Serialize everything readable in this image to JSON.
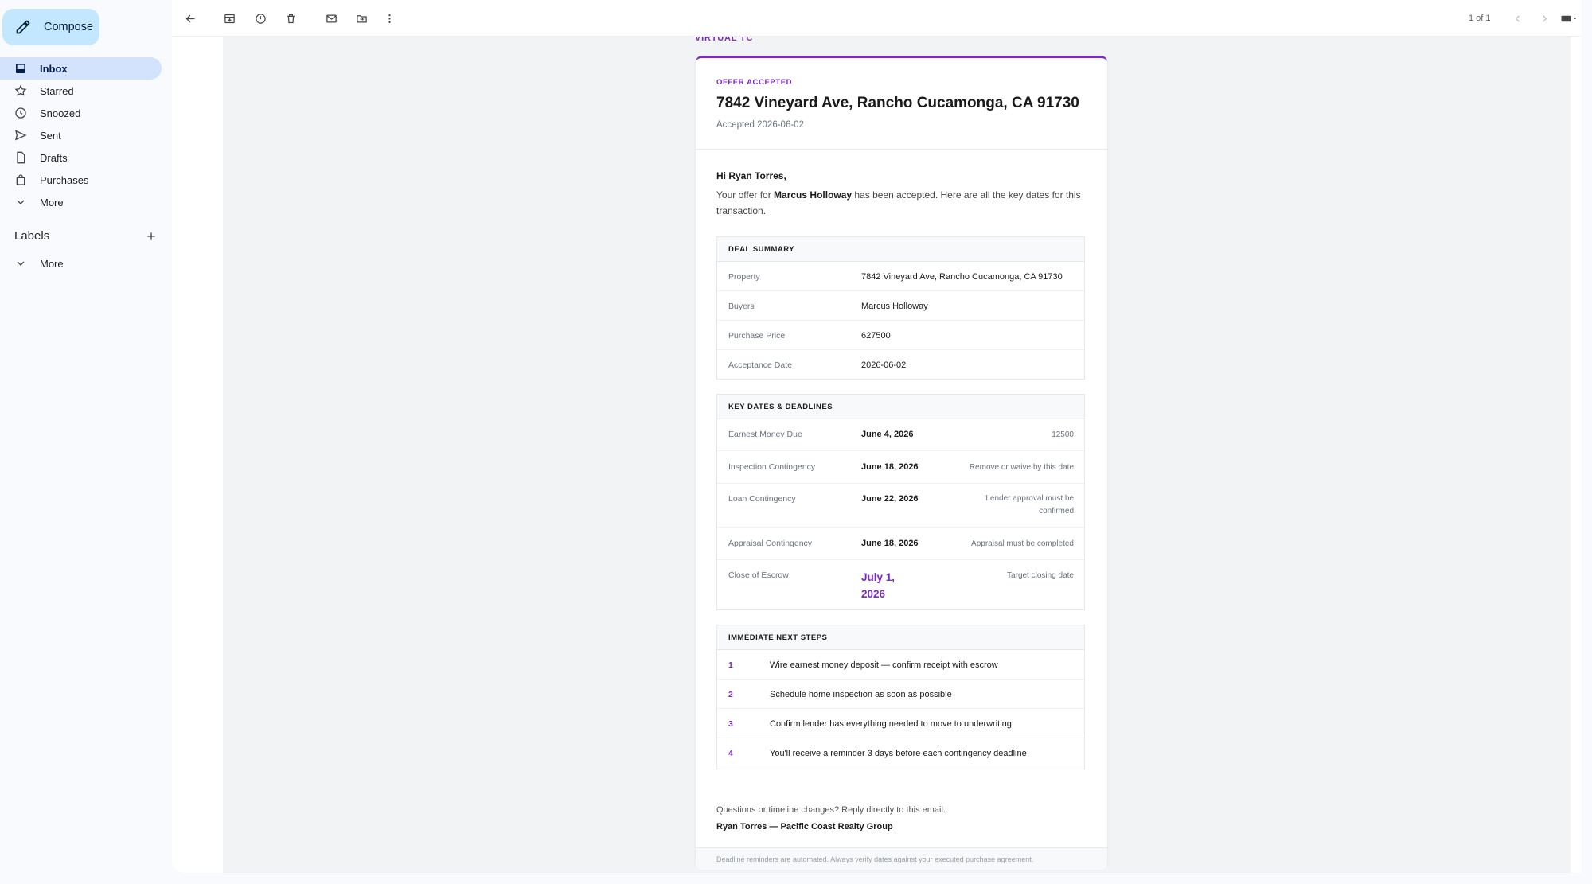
{
  "sidebar": {
    "compose_label": "Compose",
    "items": [
      {
        "label": "Inbox",
        "icon": "inbox-icon"
      },
      {
        "label": "Starred",
        "icon": "star-icon"
      },
      {
        "label": "Snoozed",
        "icon": "clock-icon"
      },
      {
        "label": "Sent",
        "icon": "send-icon"
      },
      {
        "label": "Drafts",
        "icon": "draft-icon"
      },
      {
        "label": "Purchases",
        "icon": "shopping-bag-icon"
      },
      {
        "label": "More",
        "icon": "chevron-down-icon"
      }
    ],
    "labels_title": "Labels",
    "labels_more": "More"
  },
  "toolbar": {
    "pager": "1 of 1"
  },
  "email": {
    "brand": "VIRTUAL TC",
    "badge": "OFFER ACCEPTED",
    "title": "7842 Vineyard Ave, Rancho Cucamonga, CA 91730",
    "accepted": "Accepted 2026-06-02",
    "greeting": "Hi Ryan Torres,",
    "intro_pre": "Your offer for ",
    "intro_name": "Marcus Holloway",
    "intro_post": " has been accepted. Here are all the key dates for this transaction.",
    "deal_summary": {
      "title": "DEAL SUMMARY",
      "rows": [
        {
          "label": "Property",
          "value": "7842 Vineyard Ave, Rancho Cucamonga, CA 91730"
        },
        {
          "label": "Buyers",
          "value": "Marcus Holloway"
        },
        {
          "label": "Purchase Price",
          "value": "627500"
        },
        {
          "label": "Acceptance Date",
          "value": "2026-06-02"
        }
      ]
    },
    "key_dates": {
      "title": "KEY DATES & DEADLINES",
      "rows": [
        {
          "label": "Earnest Money Due",
          "date": "June 4, 2026",
          "note": "12500"
        },
        {
          "label": "Inspection Contingency",
          "date": "June 18, 2026",
          "note": "Remove or waive by this date"
        },
        {
          "label": "Loan Contingency",
          "date": "June 22, 2026",
          "note": "Lender approval must be confirmed"
        },
        {
          "label": "Appraisal Contingency",
          "date": "June 18, 2026",
          "note": "Appraisal must be completed"
        },
        {
          "label": "Close of Escrow",
          "date": "July 1, 2026",
          "note": "Target closing date"
        }
      ]
    },
    "next_steps": {
      "title": "IMMEDIATE NEXT STEPS",
      "items": [
        {
          "num": "1",
          "text": "Wire earnest money deposit — confirm receipt with escrow"
        },
        {
          "num": "2",
          "text": "Schedule home inspection as soon as possible"
        },
        {
          "num": "3",
          "text": "Confirm lender has everything needed to move to underwriting"
        },
        {
          "num": "4",
          "text": "You'll receive a reminder 3 days before each contingency deadline"
        }
      ]
    },
    "closing": "Questions or timeline changes? Reply directly to this email.",
    "signature": "Ryan Torres — Pacific Coast Realty Group",
    "footer": "Deadline reminders are automated. Always verify dates against your executed purchase agreement."
  },
  "colors": {
    "accent": "#7b2cbf",
    "compose_bg": "#c2e7ff",
    "nav_active": "#d3e3fd"
  }
}
